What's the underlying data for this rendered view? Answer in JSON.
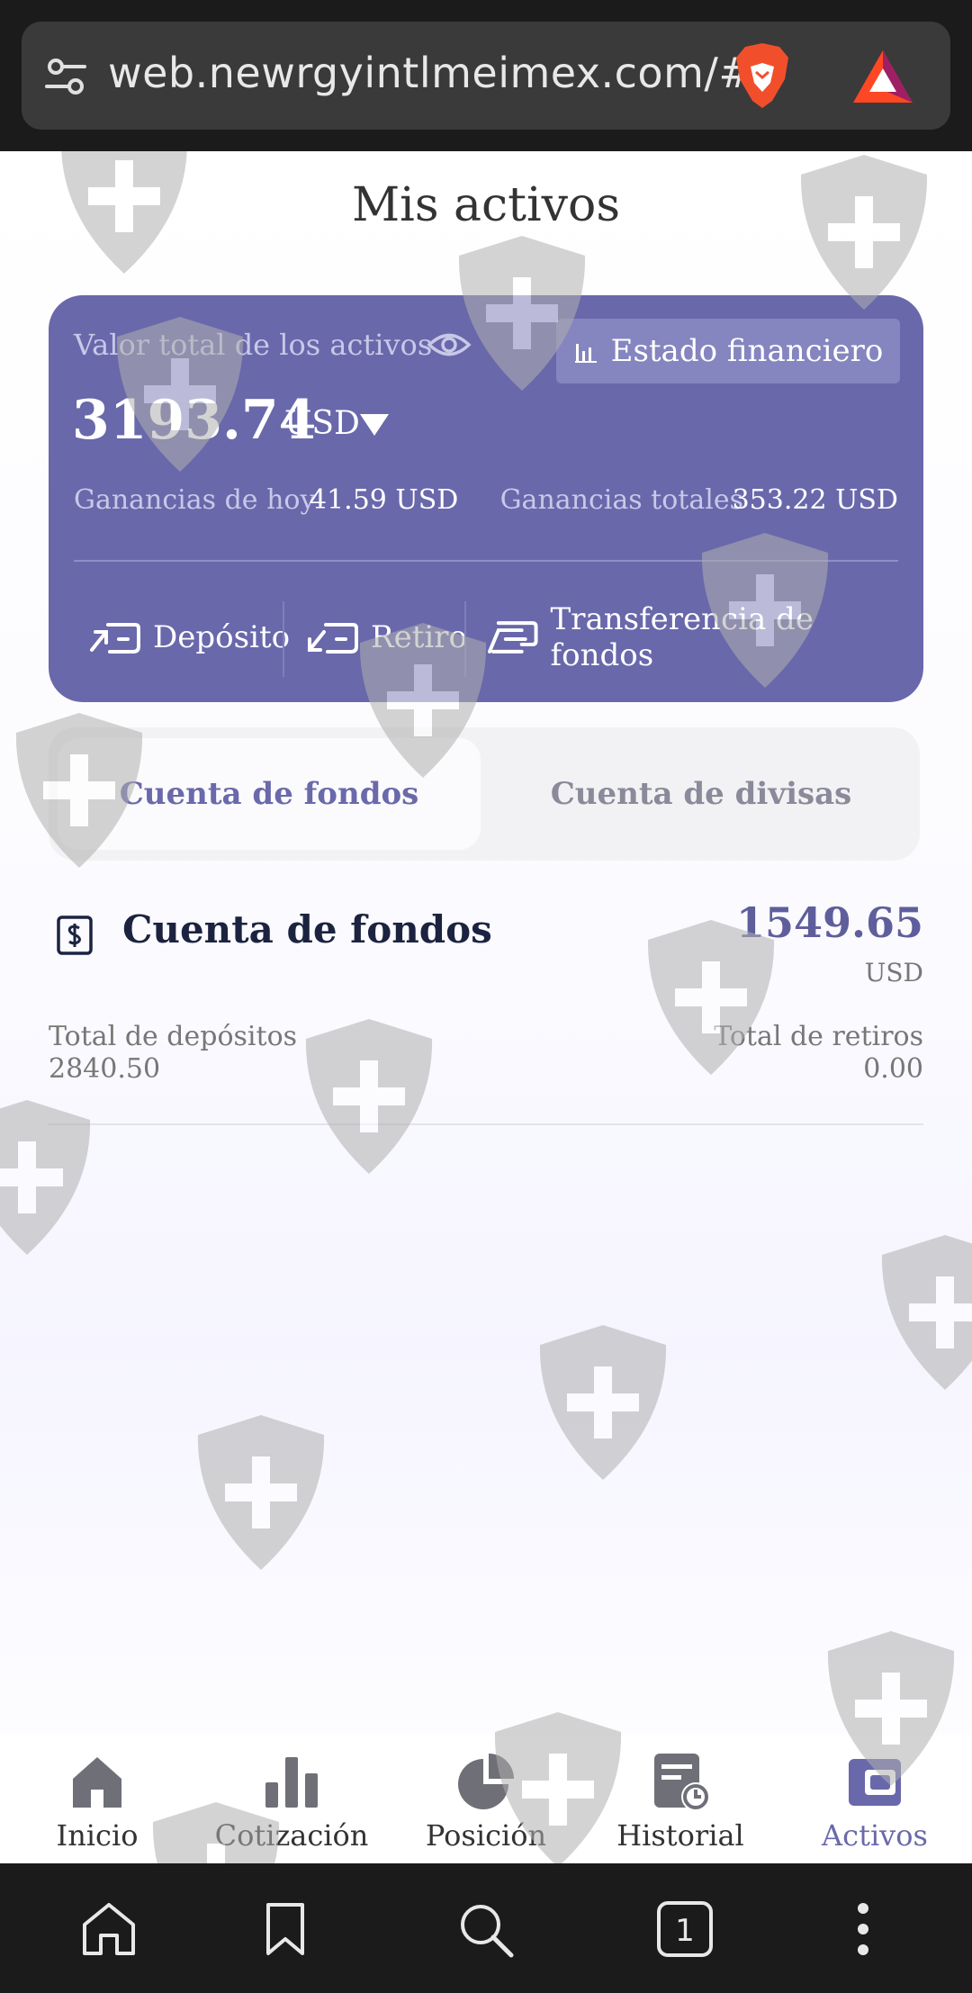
{
  "browser": {
    "url": "web.newrgyintlmeimex.com/#/",
    "tab_count": "1"
  },
  "page": {
    "title": "Mis activos"
  },
  "asset_card": {
    "total_label": "Valor total de los activos",
    "statement_button": "Estado financiero",
    "total_amount": "3193.74",
    "currency": "USD",
    "today_label": "Ganancias de hoy",
    "today_value": "41.59 USD",
    "total_gain_label": "Ganancias totales",
    "total_gain_value": "353.22 USD",
    "actions": [
      {
        "label": "Depósito",
        "icon": "deposit-icon"
      },
      {
        "label": "Retiro",
        "icon": "withdraw-icon"
      },
      {
        "label": "Transferencia de fondos",
        "icon": "transfer-icon"
      }
    ]
  },
  "tabs": [
    {
      "label": "Cuenta de fondos",
      "active": true
    },
    {
      "label": "Cuenta de divisas",
      "active": false
    }
  ],
  "fund_account": {
    "title": "Cuenta de fondos",
    "amount": "1549.65",
    "currency": "USD",
    "deposits_label": "Total de depósitos",
    "deposits_value": "2840.50",
    "withdrawals_label": "Total de retiros",
    "withdrawals_value": "0.00"
  },
  "bottom_nav": [
    {
      "label": "Inicio",
      "icon": "home-icon"
    },
    {
      "label": "Cotización",
      "icon": "bar-chart-icon"
    },
    {
      "label": "Posición",
      "icon": "pie-chart-icon"
    },
    {
      "label": "Historial",
      "icon": "history-icon"
    },
    {
      "label": "Activos",
      "icon": "wallet-icon",
      "active": true
    }
  ],
  "colors": {
    "accent": "#6968ab",
    "card_bg": "#6968ab",
    "browser_bg": "#1b1b1b"
  }
}
